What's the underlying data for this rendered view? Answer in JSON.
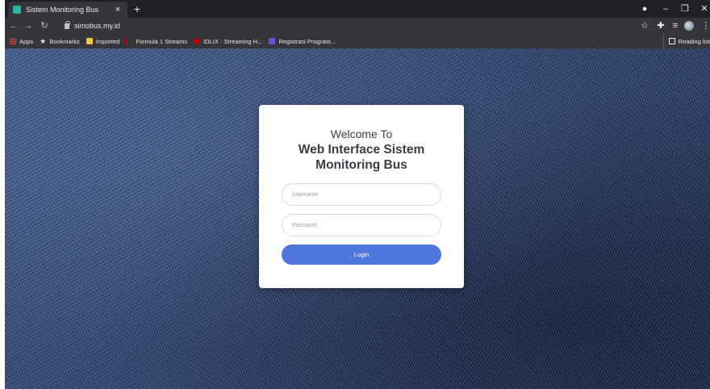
{
  "browser": {
    "tab": {
      "title": "Sistem Monitoring Bus",
      "close": "×"
    },
    "new_tab": "+",
    "url": "simobus.my.id",
    "bookmarks": [
      {
        "label": "Apps",
        "icon": "apps-grid-icon"
      },
      {
        "label": "Bookmarks",
        "icon": "star-icon"
      },
      {
        "label": "Imported",
        "icon": "folder-icon"
      },
      {
        "label": "Formula 1 Streams",
        "icon": "f1-icon"
      },
      {
        "label": "IDLIX · Streaming H...",
        "icon": "idlix-icon"
      },
      {
        "label": "Registrasi Program...",
        "icon": "registration-icon"
      }
    ],
    "reading_list": "Reading list"
  },
  "login": {
    "welcome": "Welcome To",
    "headline_line1": "Web Interface Sistem",
    "headline_line2": "Monitoring Bus",
    "username_placeholder": "Username",
    "password_placeholder": "Password",
    "login_label": "Login",
    "button_color": "#4f78dc"
  }
}
